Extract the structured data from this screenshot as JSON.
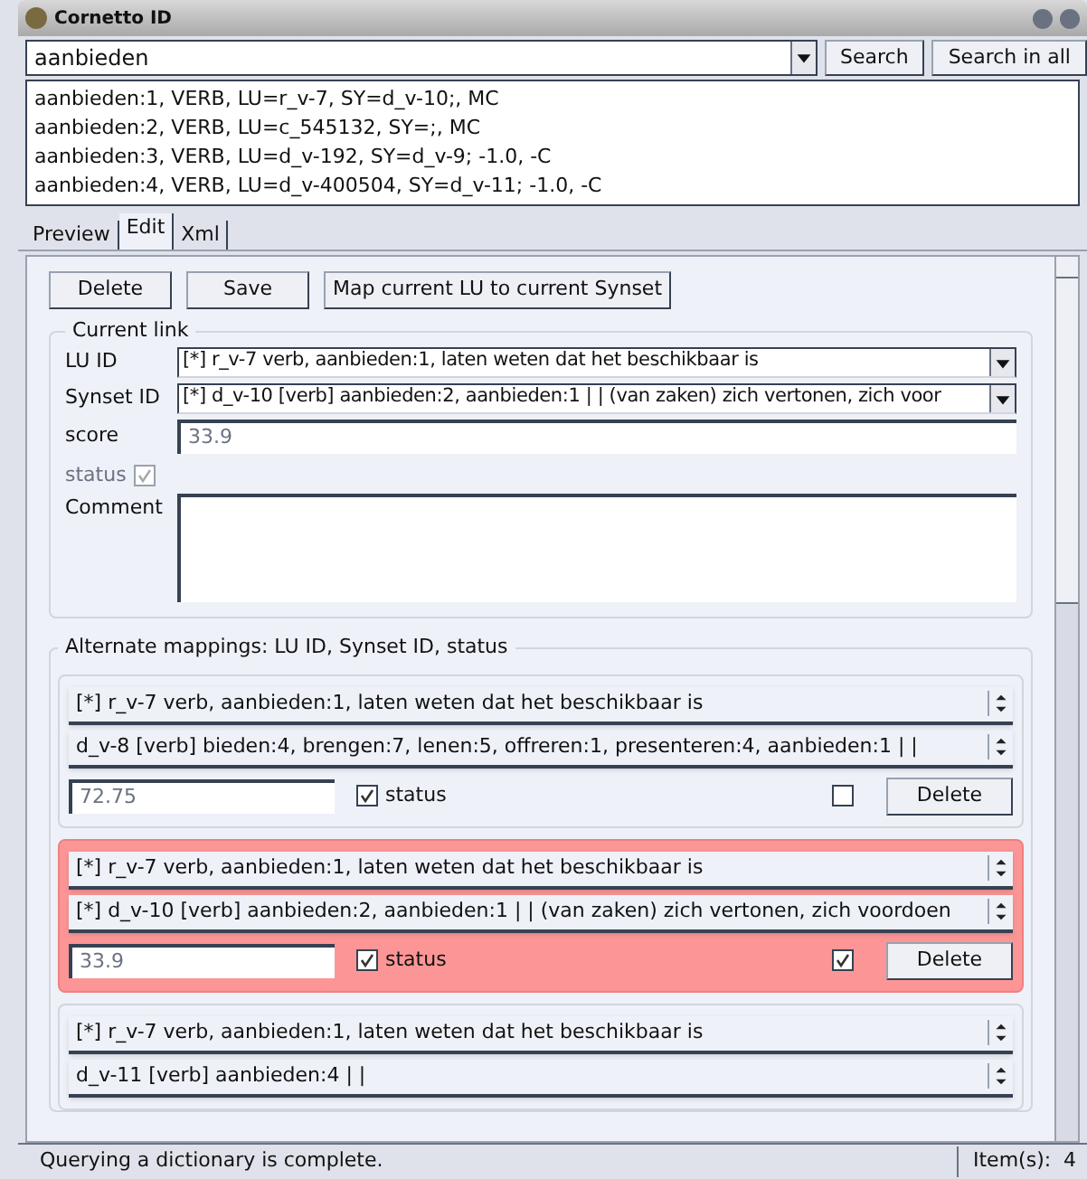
{
  "window": {
    "title": "Cornetto ID"
  },
  "search": {
    "value": "aanbieden",
    "buttons": [
      "Search",
      "Search in all"
    ]
  },
  "results": [
    "aanbieden:1, VERB, LU=r_v-7, SY=d_v-10;, MC",
    "aanbieden:2, VERB, LU=c_545132, SY=;, MC",
    "aanbieden:3, VERB, LU=d_v-192, SY=d_v-9; -1.0, -C",
    "aanbieden:4, VERB, LU=d_v-400504, SY=d_v-11; -1.0, -C"
  ],
  "tabs": [
    {
      "label": "Preview",
      "selected": false
    },
    {
      "label": "Edit",
      "selected": true
    },
    {
      "label": "Xml",
      "selected": false
    }
  ],
  "toolbar": [
    "Delete",
    "Save",
    "Map current LU to current Synset"
  ],
  "current_link": {
    "title": "Current link",
    "lu_label": "LU ID",
    "lu_value": "[*] r_v-7 verb, aanbieden:1, laten weten dat het beschikbaar is",
    "synset_label": "Synset ID",
    "synset_value": "[*] d_v-10 [verb] aanbieden:2, aanbieden:1 |  | (van zaken) zich vertonen, zich voor",
    "score_label": "score",
    "score": "33.9",
    "status_label": "status",
    "status_checked": true,
    "status_disabled": true,
    "comment_label": "Comment"
  },
  "alternates": {
    "title": "Alternate mappings: LU ID, Synset ID, status",
    "items": [
      {
        "highlighted": false,
        "lu": "[*] r_v-7 verb, aanbieden:1, laten weten dat het beschikbaar is",
        "synset": "d_v-8 [verb] bieden:4, brengen:7, lenen:5, offreren:1, presenteren:4, aanbieden:1 |  |",
        "score": "72.75",
        "status_label": "status",
        "status_checked": true,
        "mark_checked": false,
        "button": "Delete"
      },
      {
        "highlighted": true,
        "lu": "[*] r_v-7 verb, aanbieden:1, laten weten dat het beschikbaar is",
        "synset": "[*] d_v-10 [verb] aanbieden:2, aanbieden:1 |  | (van zaken) zich vertonen, zich voordoen",
        "score": "33.9",
        "status_label": "status",
        "status_checked": true,
        "mark_checked": true,
        "button": "Delete"
      },
      {
        "highlighted": false,
        "lu": "[*] r_v-7 verb, aanbieden:1, laten weten dat het beschikbaar is",
        "synset": "d_v-11 [verb] aanbieden:4 |  |"
      }
    ]
  },
  "status_bar": {
    "message": "Querying a dictionary is complete.",
    "count": "Item(s):  4"
  }
}
